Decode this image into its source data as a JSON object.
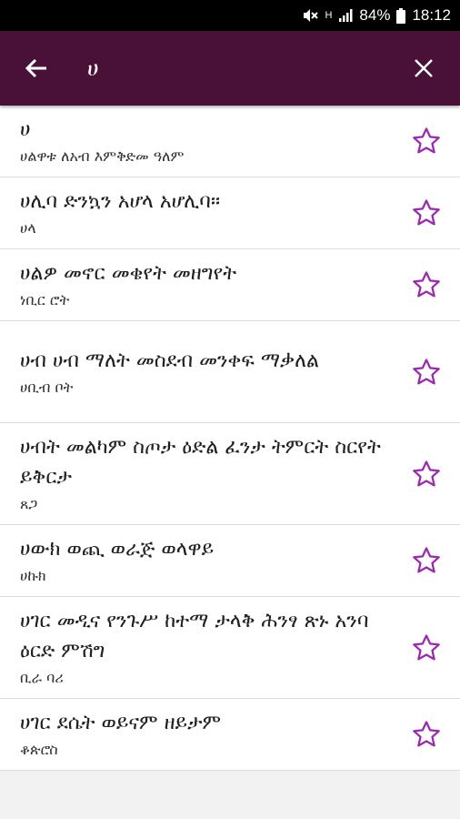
{
  "status_bar": {
    "battery_percent": "84%",
    "time": "18:12",
    "network_label": "H"
  },
  "search": {
    "value": "ሀ",
    "placeholder": ""
  },
  "colors": {
    "appbar": "#4a1138",
    "star": "#9c27b0"
  },
  "results": [
    {
      "word": "ሀ",
      "meaning": "ሀልዋቱ ለአብ እምቅድመ ዓለም"
    },
    {
      "word": "ሀሊባ ድንኳን አሆላ አሆሊባ።",
      "meaning": "ሀላ"
    },
    {
      "word": "ሀልዎ መኖር መቄየት መዘግየት",
      "meaning": "ነቢር ሮት"
    },
    {
      "word": "ሀብ ሀብ ማለት መስደብ መንቀፍ ማቃለል",
      "meaning": "ሀቢብ ቦት"
    },
    {
      "word": "ሀብት መልካም ስጦታ ዕድል ፈንታ ትምርት ስርየት ይቅርታ",
      "meaning": "ጸጋ"
    },
    {
      "word": "ሀውክ ወጪ ወራጅ ወላዋይ",
      "meaning": "ሀኩክ"
    },
    {
      "word": "ሀገር መዲና የንጉሥ ከተማ ታላቅ ሕንፃ ጽኑ አንባ ዕርድ ምሽግ",
      "meaning": "ቢራ ባሪ"
    },
    {
      "word": "ሀገር ደሴት ወይናም ዘይታም",
      "meaning": "ቆጵሮስ"
    }
  ]
}
